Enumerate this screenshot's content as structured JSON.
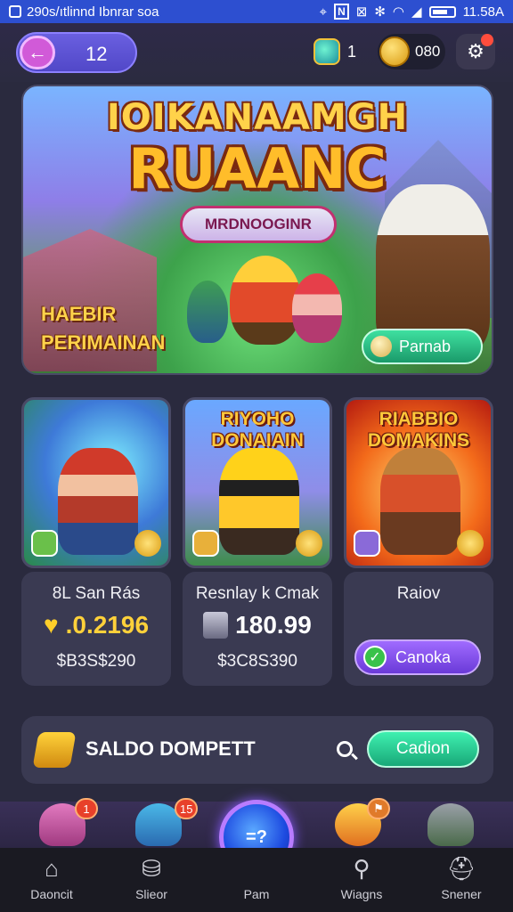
{
  "status_bar": {
    "left_text": "290s/ıtlinnd Ibnrar soa",
    "time": "11.58A"
  },
  "top_bar": {
    "level": "12",
    "gems": "1",
    "coins": "080"
  },
  "hero": {
    "title_line1": "IOIKANAAMGH",
    "title_line2": "RUAANC",
    "ribbon": "MRDNOOGINR",
    "tag_line1": "HAEBIR",
    "tag_line2": "PERIMAINAN",
    "button": "Parnab"
  },
  "cards": [
    {
      "art_title": "",
      "name": "8L San Rás",
      "value": ".0.2196",
      "price": "$B3S$290"
    },
    {
      "art_title": "RIYOHO DONAIAIN",
      "name": "Resnlay k Cmak",
      "value": "180.99",
      "price": "$3C8S390"
    },
    {
      "art_title": "RIABBIO DOMAKINS",
      "name": "Raiov",
      "button": "Canoka"
    }
  ],
  "wallet": {
    "label": "SALDO DOMPETT",
    "button": "Cadion"
  },
  "strip": {
    "badge1": "1",
    "badge2": "15",
    "fab_label": "=?"
  },
  "nav": [
    {
      "label": "Daoncit",
      "icon": "home-icon"
    },
    {
      "label": "Slieor",
      "icon": "shop-icon"
    },
    {
      "label": "Pam",
      "icon": "center-icon"
    },
    {
      "label": "Wiagns",
      "icon": "search-icon"
    },
    {
      "label": "Snener",
      "icon": "profile-icon"
    }
  ]
}
